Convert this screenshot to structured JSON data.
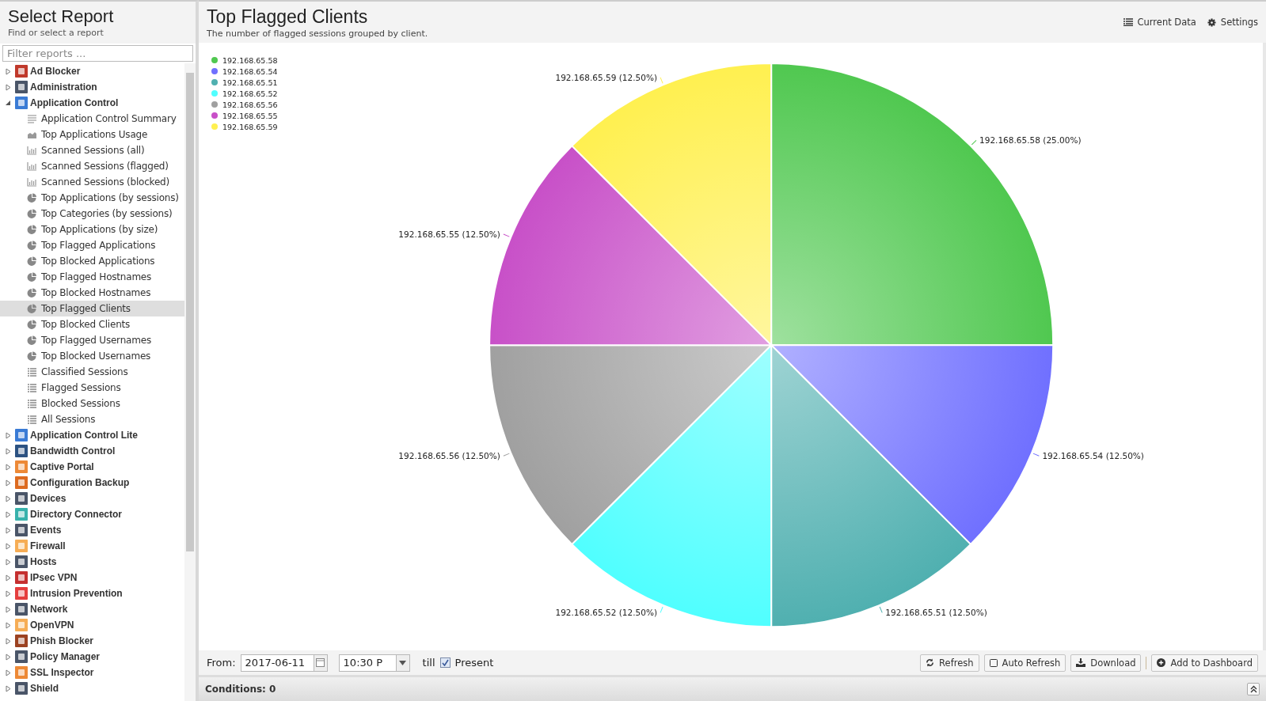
{
  "sidebar": {
    "title": "Select Report",
    "subtitle": "Find or select a report",
    "filter": {
      "placeholder": "Filter reports ..."
    },
    "items": [
      {
        "label": "Ad Blocker",
        "color": "#c0392b",
        "expanded": false
      },
      {
        "label": "Administration",
        "color": "#4a5568",
        "expanded": false
      },
      {
        "label": "Application Control",
        "color": "#3a7bd5",
        "expanded": true,
        "children": [
          {
            "label": "Application Control Summary",
            "kind": "text",
            "selected": false
          },
          {
            "label": "Top Applications Usage",
            "kind": "area",
            "selected": false
          },
          {
            "label": "Scanned Sessions (all)",
            "kind": "bar",
            "selected": false
          },
          {
            "label": "Scanned Sessions (flagged)",
            "kind": "bar",
            "selected": false
          },
          {
            "label": "Scanned Sessions (blocked)",
            "kind": "bar",
            "selected": false
          },
          {
            "label": "Top Applications (by sessions)",
            "kind": "pie",
            "selected": false
          },
          {
            "label": "Top Categories (by sessions)",
            "kind": "pie",
            "selected": false
          },
          {
            "label": "Top Applications (by size)",
            "kind": "pie",
            "selected": false
          },
          {
            "label": "Top Flagged Applications",
            "kind": "pie",
            "selected": false
          },
          {
            "label": "Top Blocked Applications",
            "kind": "pie",
            "selected": false
          },
          {
            "label": "Top Flagged Hostnames",
            "kind": "pie",
            "selected": false
          },
          {
            "label": "Top Blocked Hostnames",
            "kind": "pie",
            "selected": false
          },
          {
            "label": "Top Flagged Clients",
            "kind": "pie",
            "selected": true
          },
          {
            "label": "Top Blocked Clients",
            "kind": "pie",
            "selected": false
          },
          {
            "label": "Top Flagged Usernames",
            "kind": "pie",
            "selected": false
          },
          {
            "label": "Top Blocked Usernames",
            "kind": "pie",
            "selected": false
          },
          {
            "label": "Classified Sessions",
            "kind": "list",
            "selected": false
          },
          {
            "label": "Flagged Sessions",
            "kind": "list",
            "selected": false
          },
          {
            "label": "Blocked Sessions",
            "kind": "list",
            "selected": false
          },
          {
            "label": "All Sessions",
            "kind": "list",
            "selected": false
          }
        ]
      },
      {
        "label": "Application Control Lite",
        "color": "#3a7bd5",
        "expanded": false
      },
      {
        "label": "Bandwidth Control",
        "color": "#2c5282",
        "expanded": false
      },
      {
        "label": "Captive Portal",
        "color": "#ed8936",
        "expanded": false
      },
      {
        "label": "Configuration Backup",
        "color": "#dd6b20",
        "expanded": false
      },
      {
        "label": "Devices",
        "color": "#4a5568",
        "expanded": false
      },
      {
        "label": "Directory Connector",
        "color": "#38b2ac",
        "expanded": false
      },
      {
        "label": "Events",
        "color": "#4a5568",
        "expanded": false
      },
      {
        "label": "Firewall",
        "color": "#f6ad55",
        "expanded": false
      },
      {
        "label": "Hosts",
        "color": "#4a5568",
        "expanded": false
      },
      {
        "label": "IPsec VPN",
        "color": "#c53030",
        "expanded": false
      },
      {
        "label": "Intrusion Prevention",
        "color": "#e53e3e",
        "expanded": false
      },
      {
        "label": "Network",
        "color": "#4a5568",
        "expanded": false
      },
      {
        "label": "OpenVPN",
        "color": "#f6ad55",
        "expanded": false
      },
      {
        "label": "Phish Blocker",
        "color": "#9c4221",
        "expanded": false
      },
      {
        "label": "Policy Manager",
        "color": "#4a5568",
        "expanded": false
      },
      {
        "label": "SSL Inspector",
        "color": "#ed8936",
        "expanded": false
      },
      {
        "label": "Shield",
        "color": "#4a5568",
        "expanded": false
      }
    ]
  },
  "report": {
    "title": "Top Flagged Clients",
    "description": "The number of flagged sessions grouped by client.",
    "actions": [
      {
        "label": "Current Data"
      },
      {
        "label": "Settings"
      }
    ],
    "chart_data": {
      "type": "pie",
      "categories": [
        "192.168.65.58",
        "192.168.65.54",
        "192.168.65.51",
        "192.168.65.52",
        "192.168.65.56",
        "192.168.65.55",
        "192.168.65.59"
      ],
      "values": [
        25,
        12.5,
        12.5,
        12.5,
        12.5,
        12.5,
        12.5
      ],
      "colors": [
        "#50c850",
        "#7070ff",
        "#50b0b0",
        "#50ffff",
        "#a0a0a0",
        "#c850c8",
        "#fff050"
      ],
      "value_labels": [
        "192.168.65.58 (25.00%)",
        "192.168.65.54 (12.50%)",
        "192.168.65.51 (12.50%)",
        "192.168.65.52 (12.50%)",
        "192.168.65.56 (12.50%)",
        "192.168.65.55 (12.50%)",
        "192.168.65.59 (12.50%)"
      ]
    }
  },
  "toolbar": {
    "from_label": "From:",
    "date": "2017-06-11",
    "time": "10:30 P",
    "till_label": "till",
    "present": {
      "label": "Present",
      "checked": true
    },
    "buttons": [
      {
        "label": "Refresh"
      },
      {
        "label": "Auto Refresh"
      },
      {
        "label": "Download"
      },
      {
        "label": "Add to Dashboard"
      }
    ]
  },
  "conditions": {
    "label": "Conditions: 0"
  }
}
